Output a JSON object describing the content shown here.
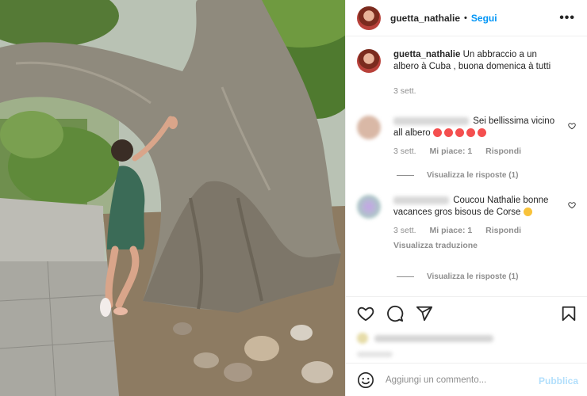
{
  "post": {
    "username": "guetta_nathalie",
    "follow_label": "Segui",
    "more_label": "•••"
  },
  "caption": {
    "username": "guetta_nathalie",
    "text": "Un abbraccio a un albero à Cuba , buona domenica à tutti",
    "time": "3 sett."
  },
  "comments": [
    {
      "text": "Sei bellissima vicino all albero",
      "emoji_count": 5,
      "time": "3 sett.",
      "likes": "Mi piace: 1",
      "reply": "Rispondi",
      "view_replies": "Visualizza le risposte (1)"
    },
    {
      "text": "Coucou Nathalie bonne vacances gros bisous de Corse",
      "time": "3 sett.",
      "likes": "Mi piace: 1",
      "reply": "Rispondi",
      "translate": "Visualizza traduzione",
      "view_replies": "Visualizza le risposte (1)"
    }
  ],
  "add_comment": {
    "placeholder": "Aggiungi un commento...",
    "publish_label": "Pubblica"
  },
  "icons": [
    "heart-icon",
    "comment-icon",
    "share-icon",
    "bookmark-icon",
    "emoji-icon",
    "more-options-icon"
  ],
  "colors": {
    "accent": "#0095f6",
    "publish_disabled": "#b2dffc",
    "text": "#262626",
    "muted": "#8e8e8e"
  }
}
